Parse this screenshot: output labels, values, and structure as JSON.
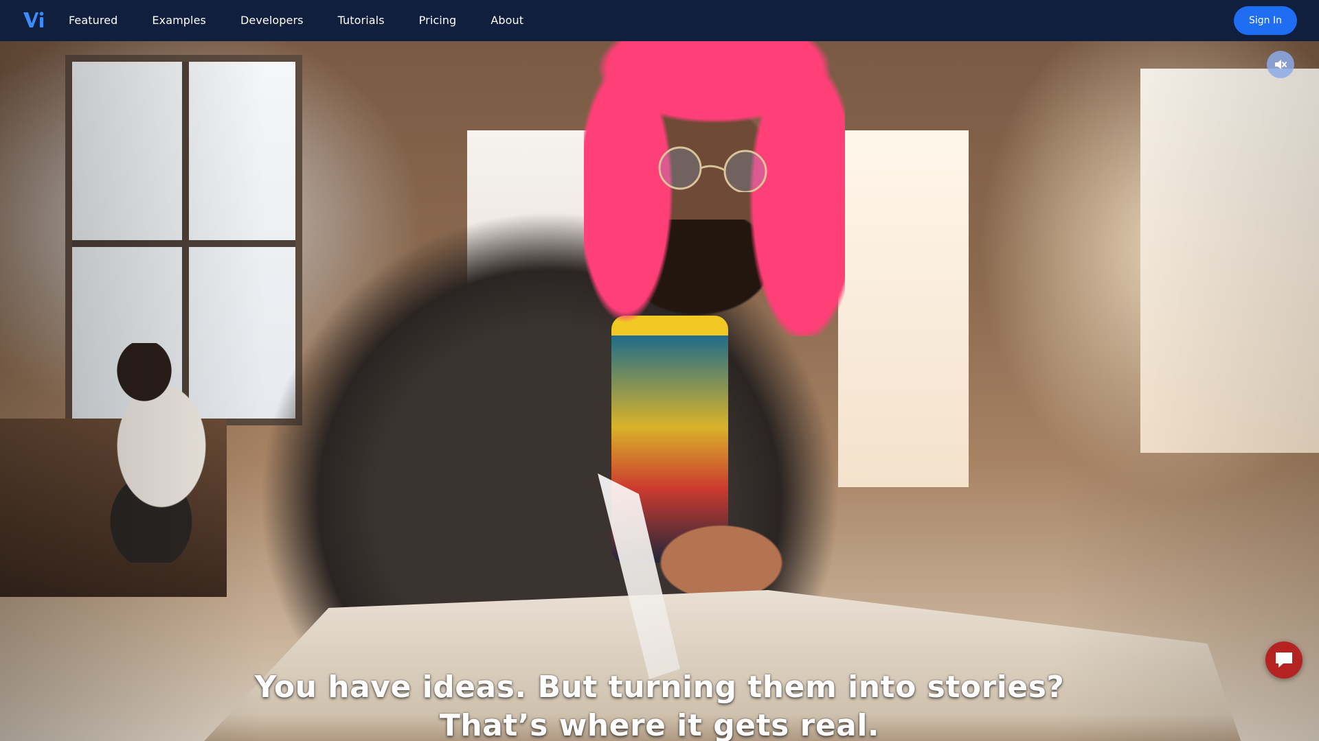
{
  "brand": {
    "logo_icon": "vi-logo",
    "accent": "#1f6df2",
    "nav_bg": "#0f1f3d"
  },
  "nav": {
    "links": [
      {
        "label": "Featured"
      },
      {
        "label": "Examples"
      },
      {
        "label": "Developers"
      },
      {
        "label": "Tutorials"
      },
      {
        "label": "Pricing"
      },
      {
        "label": "About"
      }
    ],
    "signin_label": "Sign In"
  },
  "hero": {
    "subtitle_line1": "You have ideas. But turning them into stories?",
    "subtitle_line2": "That’s where it gets real.",
    "mute_icon": "speaker-muted-icon",
    "chat_icon": "chat-bubble-icon",
    "chat_color": "#b42222"
  }
}
